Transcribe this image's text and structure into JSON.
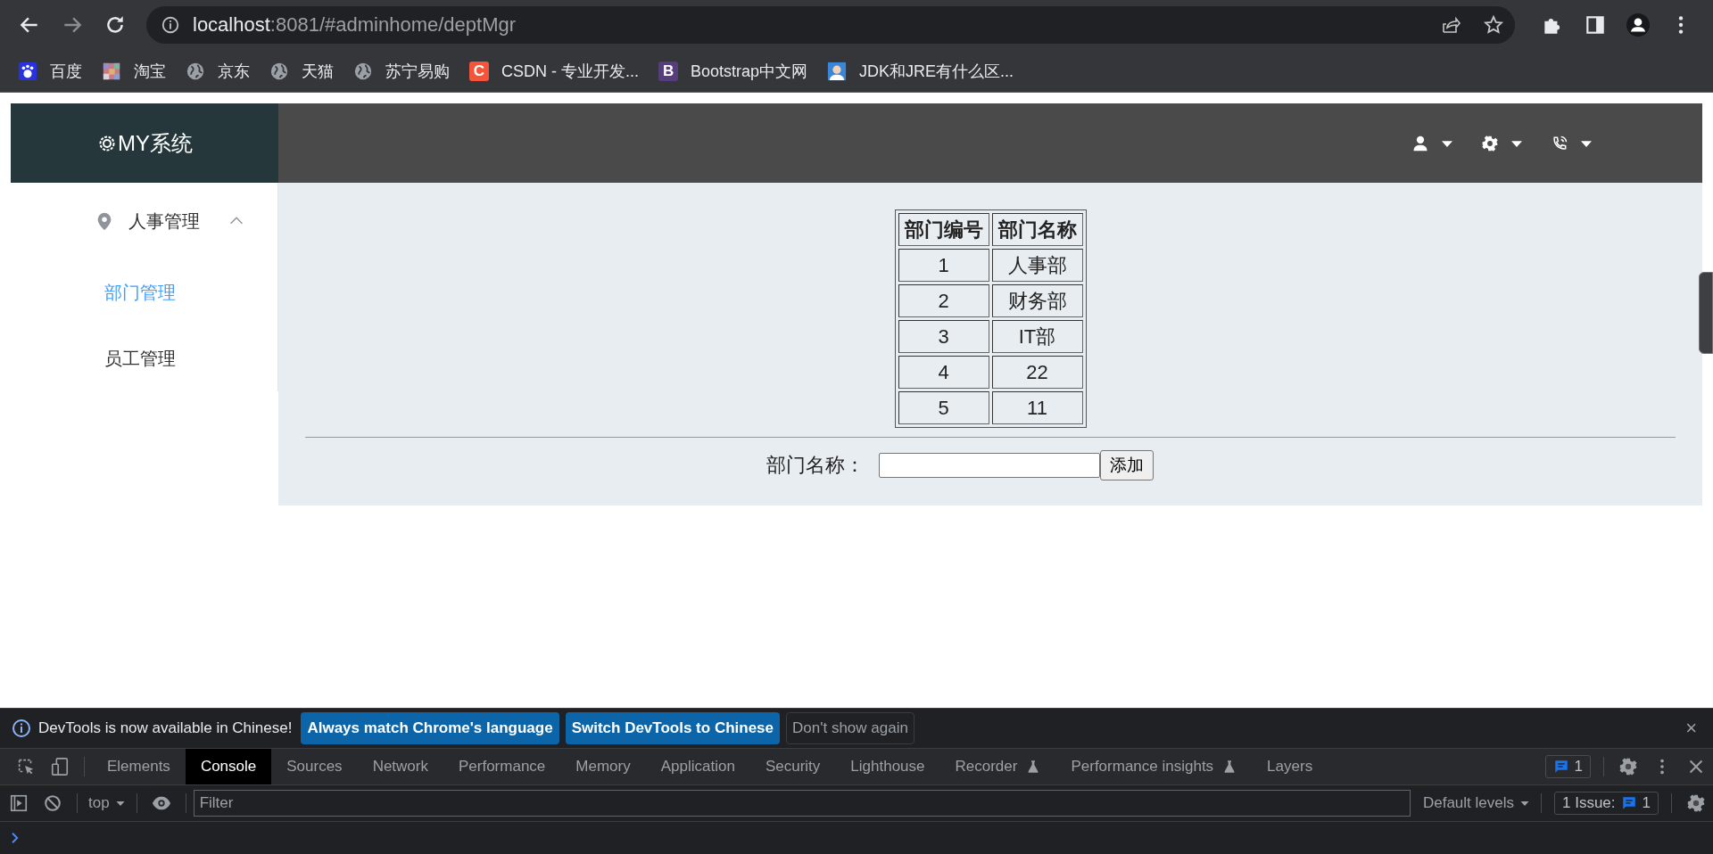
{
  "browser": {
    "nav": [
      {
        "kind": "back",
        "disabled": false
      },
      {
        "kind": "forward",
        "disabled": true
      },
      {
        "kind": "reload",
        "disabled": false
      }
    ],
    "address": {
      "host": "localhost",
      "rest": ":8081/#adminhome/deptMgr"
    },
    "toolbar": [
      {
        "kind": "share"
      },
      {
        "kind": "star"
      },
      {
        "kind": "puzzle"
      },
      {
        "kind": "sidepanel"
      },
      {
        "kind": "profile"
      },
      {
        "kind": "dots"
      }
    ],
    "bookmarks": [
      {
        "label": "百度",
        "kind": "paw"
      },
      {
        "label": "淘宝",
        "kind": "mosaic"
      },
      {
        "label": "京东",
        "kind": "globe"
      },
      {
        "label": "天猫",
        "kind": "globe"
      },
      {
        "label": "苏宁易购",
        "kind": "globe"
      },
      {
        "label": "CSDN - 专业开发...",
        "kind": "letter",
        "icon_text": "C",
        "color": "#f4553a"
      },
      {
        "label": "Bootstrap中文网",
        "kind": "letter",
        "icon_text": "B",
        "color": "#563d7c"
      },
      {
        "label": "JDK和JRE有什么区...",
        "kind": "avatar"
      }
    ]
  },
  "app": {
    "logo": "MY系统",
    "header_menus": [
      {
        "kind": "user"
      },
      {
        "kind": "gear"
      },
      {
        "kind": "phone"
      }
    ],
    "sidebar": {
      "items": [
        {
          "label": "人事管理",
          "expanded": true,
          "children": [
            {
              "label": "部门管理",
              "selected": true
            },
            {
              "label": "员工管理",
              "selected": false
            }
          ]
        }
      ]
    },
    "table": {
      "columns": [
        "部门编号",
        "部门名称"
      ],
      "rows": [
        [
          "1",
          "人事部"
        ],
        [
          "2",
          "财务部"
        ],
        [
          "3",
          "IT部"
        ],
        [
          "4",
          "22"
        ],
        [
          "5",
          "11"
        ]
      ]
    },
    "form": {
      "label": "部门名称：",
      "button": "添加"
    }
  },
  "devtools": {
    "infobar": {
      "message": "DevTools is now available in Chinese!",
      "buttons": [
        {
          "label": "Always match Chrome's language",
          "kind": "primary"
        },
        {
          "label": "Switch DevTools to Chinese",
          "kind": "primary"
        },
        {
          "label": "Don't show again",
          "kind": "plain"
        }
      ],
      "close": "×"
    },
    "tabs": [
      {
        "label": "Elements",
        "selected": false,
        "experimental": false
      },
      {
        "label": "Console",
        "selected": true,
        "experimental": false
      },
      {
        "label": "Sources",
        "selected": false,
        "experimental": false
      },
      {
        "label": "Network",
        "selected": false,
        "experimental": false
      },
      {
        "label": "Performance",
        "selected": false,
        "experimental": false
      },
      {
        "label": "Memory",
        "selected": false,
        "experimental": false
      },
      {
        "label": "Application",
        "selected": false,
        "experimental": false
      },
      {
        "label": "Security",
        "selected": false,
        "experimental": false
      },
      {
        "label": "Lighthouse",
        "selected": false,
        "experimental": false
      },
      {
        "label": "Recorder",
        "selected": false,
        "experimental": true
      },
      {
        "label": "Performance insights",
        "selected": false,
        "experimental": true
      },
      {
        "label": "Layers",
        "selected": false,
        "experimental": false
      }
    ],
    "issues_count": "1",
    "console": {
      "context": "top",
      "filter_placeholder": "Filter",
      "levels": "Default levels",
      "issues_label": "1 Issue:",
      "issues_count": "1"
    }
  }
}
